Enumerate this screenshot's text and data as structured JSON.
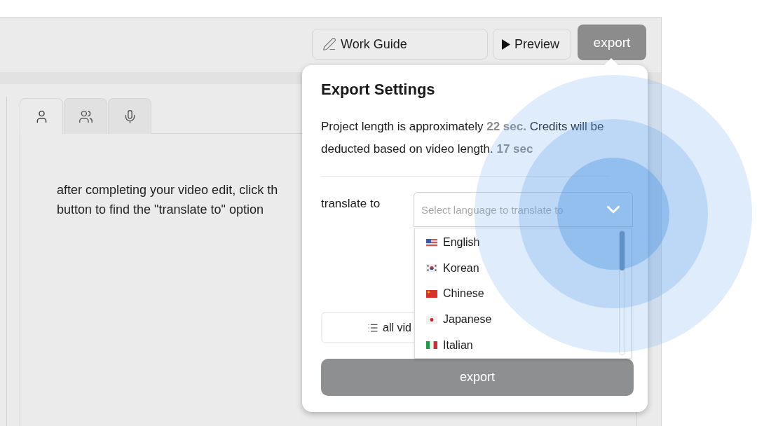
{
  "toolbar": {
    "buttons": [
      {
        "kind": "guide",
        "label": "Work Guide"
      },
      {
        "kind": "preview",
        "label": "Preview"
      },
      {
        "kind": "export",
        "label": "export"
      }
    ]
  },
  "tabs": [
    {
      "kind": "person",
      "selected": true
    },
    {
      "kind": "group",
      "selected": false
    },
    {
      "kind": "mic",
      "selected": false
    }
  ],
  "instruction": {
    "lines": [
      "after completing your video edit, click th",
      "button to find the \"translate to\" option"
    ]
  },
  "export_settings": {
    "title": "Export Settings",
    "summary": "Project length is approximately **22 sec.** Credits will be deducted based on video length. **17 sec**",
    "field_label": "translate to",
    "select": {
      "placeholder": "Select language to translate to",
      "expanded": true
    },
    "options": [
      {
        "kind": "usa",
        "label": "English"
      },
      {
        "kind": "korea",
        "label": "Korean"
      },
      {
        "kind": "china",
        "label": "Chinese"
      },
      {
        "kind": "japan",
        "label": "Japanese"
      },
      {
        "kind": "italy",
        "label": "Italian"
      }
    ],
    "list_button": "all vid",
    "export_button": "export"
  }
}
